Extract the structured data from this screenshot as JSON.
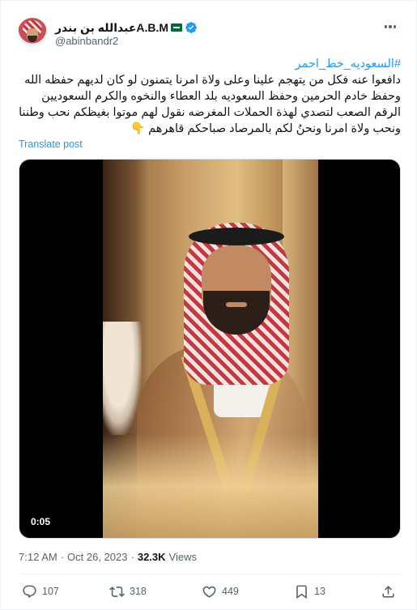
{
  "author": {
    "display_name": "عبدالله بن بندرA.B.M",
    "handle": "@abinbandr2",
    "verified": true,
    "flag_color": "#006c35"
  },
  "tweet": {
    "hashtag": "#السعوديه_خط_احمر",
    "body": "دافعوا عنه فكل من يتهجم علينا وعلى ولاة امرنا يتمنون لو كان لديهم حفظه الله وحفظ خادم الحرمين وحفظ السعوديه بلد العطاء والنخوه والكرم السعوديين الرقم الصعب لتصدي لهذة الحملات المغرضه نقول لهم موتوا بغيظكم نحب وطننا ونحب ولاة امرنا ونحنُ لكم بالمرصاد صباحكم قاهرهم 👇",
    "translate_label": "Translate post"
  },
  "media": {
    "duration": "0:05"
  },
  "meta": {
    "time": "7:12 AM",
    "separator": "·",
    "date": "Oct 26, 2023",
    "views_count": "32.3K",
    "views_label": "Views"
  },
  "actions": {
    "replies": "107",
    "retweets": "318",
    "likes": "449",
    "bookmarks": "13"
  },
  "icons": {
    "verified": "verified-badge-icon",
    "more": "more-horizontal-icon",
    "reply": "reply-icon",
    "retweet": "retweet-icon",
    "like": "heart-icon",
    "bookmark": "bookmark-icon",
    "share": "share-icon"
  },
  "colors": {
    "accent": "#1d9bf0",
    "secondary_text": "#536471",
    "primary_text": "#0f1419"
  }
}
